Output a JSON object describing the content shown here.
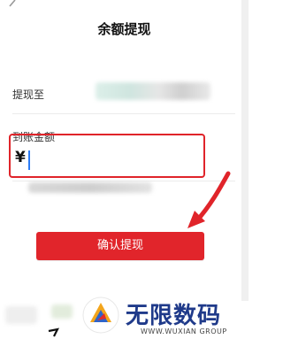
{
  "header": {
    "title": "余额提现"
  },
  "form": {
    "destination_label": "提现至",
    "amount_label": "到账金额",
    "currency_symbol": "¥",
    "amount_value": ""
  },
  "actions": {
    "confirm_label": "确认提现"
  },
  "watermark": {
    "name": "无限数码",
    "subtitle": "WWW.WUXIAN GROUP"
  },
  "colors": {
    "accent": "#e1252b",
    "highlight": "#e0242a",
    "caret": "#2d7cf6",
    "watermark": "#1f3a8a"
  },
  "icons": {
    "back": "chevron-left-icon",
    "annotation": "red-arrow-icon"
  }
}
